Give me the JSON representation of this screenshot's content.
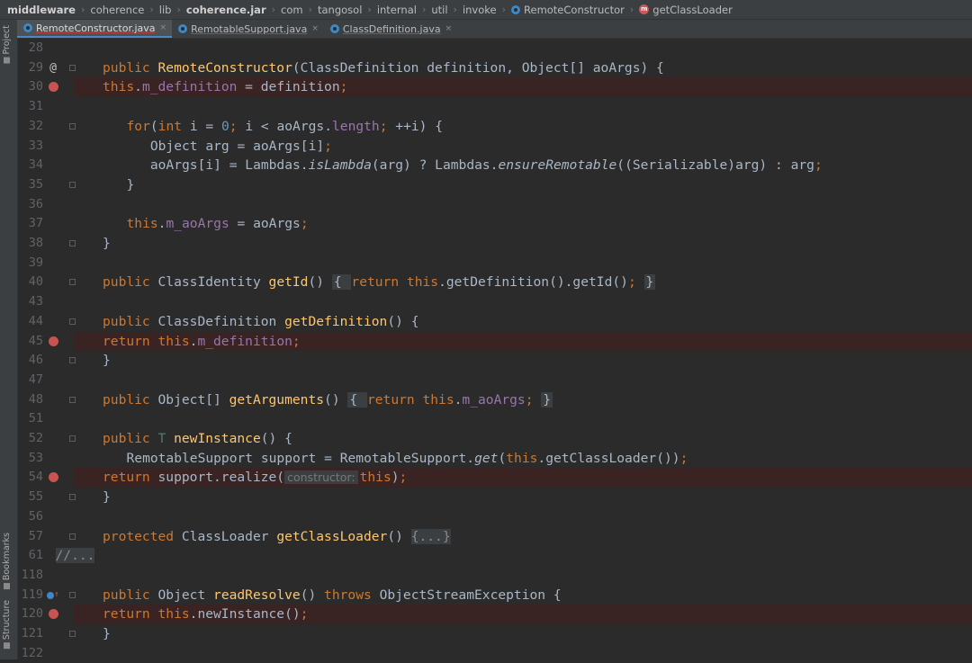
{
  "breadcrumb": [
    "middleware",
    "coherence",
    "lib",
    "coherence.jar",
    "com",
    "tangosol",
    "internal",
    "util",
    "invoke",
    "RemoteConstructor",
    "getClassLoader"
  ],
  "tool_windows": {
    "project": "Project",
    "bookmarks": "Bookmarks",
    "structure": "Structure"
  },
  "tabs": [
    {
      "label": "RemoteConstructor.java",
      "active": true
    },
    {
      "label": "RemotableSupport.java",
      "active": false
    },
    {
      "label": "ClassDefinition.java",
      "active": false
    }
  ],
  "close_glyph": "×",
  "lines": [
    {
      "n": "28",
      "tokens": []
    },
    {
      "n": "29",
      "gutter": "@",
      "fold": true,
      "tokens": [
        [
          "k",
          "public "
        ],
        [
          "fn",
          "RemoteConstructor"
        ],
        [
          "",
          "(ClassDefinition definition, Object[] aoArgs) {"
        ]
      ]
    },
    {
      "n": "30",
      "bp": true,
      "tokens": [
        [
          "k",
          "this"
        ],
        [
          "",
          "."
        ],
        [
          "fld",
          "m_definition"
        ],
        [
          "",
          " = definition"
        ],
        [
          "k",
          ";"
        ]
      ]
    },
    {
      "n": "31",
      "tokens": []
    },
    {
      "n": "32",
      "fold": true,
      "tokens": [
        [
          "k",
          "for"
        ],
        [
          "",
          "("
        ],
        [
          "k",
          "int "
        ],
        [
          "",
          "i = "
        ],
        [
          "num",
          "0"
        ],
        [
          "k",
          "; "
        ],
        [
          "",
          "i < aoArgs."
        ],
        [
          "fld",
          "length"
        ],
        [
          "k",
          "; "
        ],
        [
          "",
          "++i) {"
        ]
      ]
    },
    {
      "n": "33",
      "tokens": [
        [
          "",
          "   Object arg = aoArgs[i]"
        ],
        [
          "k",
          ";"
        ]
      ]
    },
    {
      "n": "34",
      "tokens": [
        [
          "",
          "   aoArgs[i] = Lambdas."
        ],
        [
          "it",
          "isLambda"
        ],
        [
          "",
          "(arg) ? Lambdas."
        ],
        [
          "it",
          "ensureRemotable"
        ],
        [
          "",
          "((Serializable)arg) : arg"
        ],
        [
          "k",
          ";"
        ]
      ]
    },
    {
      "n": "35",
      "fold": true,
      "tokens": [
        [
          "",
          "}"
        ]
      ]
    },
    {
      "n": "36",
      "tokens": []
    },
    {
      "n": "37",
      "tokens": [
        [
          "k",
          "this"
        ],
        [
          "",
          "."
        ],
        [
          "fld",
          "m_aoArgs"
        ],
        [
          "",
          " = aoArgs"
        ],
        [
          "k",
          ";"
        ]
      ]
    },
    {
      "n": "38",
      "fold": true,
      "tokens": [
        [
          "",
          "}"
        ]
      ],
      "indent": 0
    },
    {
      "n": "39",
      "tokens": []
    },
    {
      "n": "40",
      "fold": true,
      "indent": 0,
      "tokens": [
        [
          "k",
          "public "
        ],
        [
          "",
          "ClassIdentity "
        ],
        [
          "fn",
          "getId"
        ],
        [
          "",
          "() "
        ],
        [
          "fb",
          "{ "
        ],
        [
          "k",
          "return this"
        ],
        [
          "",
          ".getDefinition().getId()"
        ],
        [
          "k",
          "; "
        ],
        [
          "fb",
          "}"
        ]
      ]
    },
    {
      "n": "43",
      "tokens": []
    },
    {
      "n": "44",
      "fold": true,
      "indent": 0,
      "tokens": [
        [
          "k",
          "public "
        ],
        [
          "",
          "ClassDefinition "
        ],
        [
          "fn",
          "getDefinition"
        ],
        [
          "",
          "() {"
        ]
      ]
    },
    {
      "n": "45",
      "bp": true,
      "tokens": [
        [
          "k",
          "return this"
        ],
        [
          "",
          "."
        ],
        [
          "fld",
          "m_definition"
        ],
        [
          "k",
          ";"
        ]
      ]
    },
    {
      "n": "46",
      "fold": true,
      "indent": 0,
      "tokens": [
        [
          "",
          "}"
        ]
      ]
    },
    {
      "n": "47",
      "tokens": []
    },
    {
      "n": "48",
      "fold": true,
      "indent": 0,
      "tokens": [
        [
          "k",
          "public "
        ],
        [
          "",
          "Object[] "
        ],
        [
          "fn",
          "getArguments"
        ],
        [
          "",
          "() "
        ],
        [
          "fb",
          "{ "
        ],
        [
          "k",
          "return this"
        ],
        [
          "",
          "."
        ],
        [
          "fld",
          "m_aoArgs"
        ],
        [
          "k",
          "; "
        ],
        [
          "fb",
          "}"
        ]
      ]
    },
    {
      "n": "51",
      "tokens": []
    },
    {
      "n": "52",
      "fold": true,
      "indent": 0,
      "tokens": [
        [
          "k",
          "public "
        ],
        [
          "tp",
          "T "
        ],
        [
          "fn",
          "newInstance"
        ],
        [
          "",
          "() {"
        ]
      ]
    },
    {
      "n": "53",
      "tokens": [
        [
          "",
          "RemotableSupport support = RemotableSupport."
        ],
        [
          "it",
          "get"
        ],
        [
          "",
          "("
        ],
        [
          "k",
          "this"
        ],
        [
          "",
          ".getClassLoader())"
        ],
        [
          "k",
          ";"
        ]
      ]
    },
    {
      "n": "54",
      "bp": true,
      "tokens": [
        [
          "k",
          "return "
        ],
        [
          "",
          "support.realize("
        ],
        [
          "hint",
          "constructor:"
        ],
        [
          "k",
          "this"
        ],
        [
          "",
          ")"
        ],
        [
          "k",
          ";"
        ]
      ]
    },
    {
      "n": "55",
      "fold": true,
      "indent": 0,
      "tokens": [
        [
          "",
          "}"
        ]
      ]
    },
    {
      "n": "56",
      "tokens": []
    },
    {
      "n": "57",
      "fold": true,
      "indent": 0,
      "tokens": [
        [
          "k",
          "protected "
        ],
        [
          "",
          "ClassLoader "
        ],
        [
          "fn",
          "getClassLoader"
        ],
        [
          "",
          "() "
        ],
        [
          "fold-inline",
          "{...}"
        ]
      ]
    },
    {
      "n": "61",
      "fold": true,
      "indent": -1,
      "tokens": [
        [
          "fold-inline",
          "//..."
        ]
      ]
    },
    {
      "n": "118",
      "tokens": []
    },
    {
      "n": "119",
      "gutter": "override",
      "fold": true,
      "indent": 0,
      "tokens": [
        [
          "k",
          "public "
        ],
        [
          "",
          "Object "
        ],
        [
          "fn",
          "readResolve"
        ],
        [
          "",
          "() "
        ],
        [
          "k",
          "throws "
        ],
        [
          "",
          "ObjectStreamException {"
        ]
      ]
    },
    {
      "n": "120",
      "bp": true,
      "tokens": [
        [
          "k",
          "return this"
        ],
        [
          "",
          ".newInstance()"
        ],
        [
          "k",
          ";"
        ]
      ]
    },
    {
      "n": "121",
      "fold": true,
      "indent": 0,
      "tokens": [
        [
          "",
          "}"
        ]
      ]
    },
    {
      "n": "122",
      "tokens": []
    }
  ]
}
